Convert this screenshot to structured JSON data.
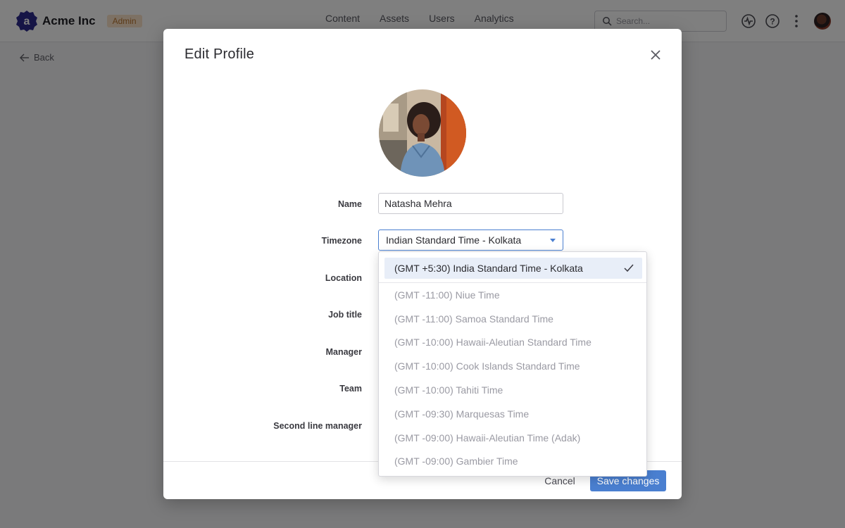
{
  "app": {
    "brand_name": "Acme Inc",
    "role_badge": "Admin",
    "nav": [
      "Content",
      "Assets",
      "Users",
      "Analytics"
    ],
    "search_placeholder": "Search...",
    "back_label": "Back"
  },
  "modal": {
    "title": "Edit Profile",
    "labels": {
      "name": "Name",
      "timezone": "Timezone",
      "location": "Location",
      "job_title": "Job title",
      "manager": "Manager",
      "team": "Team",
      "second_line_manager": "Second line manager"
    },
    "name_value": "Natasha Mehra",
    "timezone_value": "Indian Standard Time - Kolkata",
    "cancel_label": "Cancel",
    "save_label": "Save changes"
  },
  "timezone_dropdown": {
    "selected": "(GMT +5:30) India Standard Time - Kolkata",
    "options": [
      "(GMT -11:00) Niue Time",
      "(GMT -11:00) Samoa Standard Time",
      "(GMT -10:00) Hawaii-Aleutian Standard Time",
      "(GMT -10:00) Cook Islands Standard Time",
      "(GMT -10:00) Tahiti Time",
      "(GMT -09:30) Marquesas Time",
      "(GMT -09:00) Hawaii-Aleutian Time (Adak)",
      "(GMT -09:00) Gambier Time"
    ]
  },
  "colors": {
    "brand": "#2c2a8c",
    "primary": "#4a7fd0",
    "badge_bg": "#fbe3c8",
    "selected_bg": "#e8eef8"
  }
}
